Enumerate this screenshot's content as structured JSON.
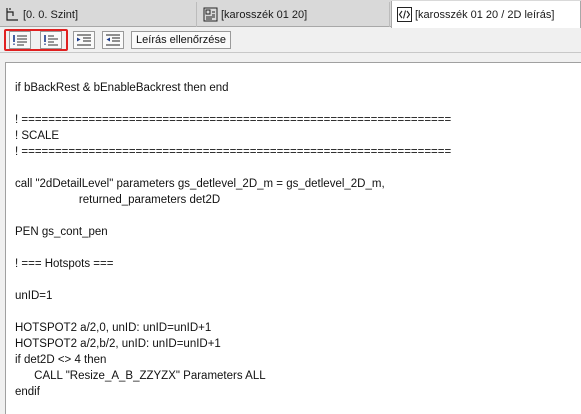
{
  "tabs": [
    {
      "label": "[0. 0. Szint]",
      "icon": "floor-plan-icon"
    },
    {
      "label": "[karosszék 01 20]",
      "icon": "object-editor-icon"
    },
    {
      "label": "[karosszék 01 20 / 2D leírás]",
      "icon": "script-code-icon",
      "active": true
    }
  ],
  "toolbar": {
    "buttons": [
      {
        "icon": "comment-lines-icon"
      },
      {
        "icon": "uncomment-lines-icon"
      },
      {
        "icon": "indent-icon"
      },
      {
        "icon": "outdent-icon"
      }
    ],
    "check_script_label": "Leírás ellenőrzése",
    "highlight_color": "#e02020"
  },
  "editor": {
    "lines": [
      "if bBackRest & bEnableBackrest then end",
      "",
      "! ================================================================",
      "! SCALE",
      "! ================================================================",
      "",
      "call \"2dDetailLevel\" parameters gs_detlevel_2D_m = gs_detlevel_2D_m,",
      "                    returned_parameters det2D",
      "",
      "PEN gs_cont_pen",
      "",
      "! === Hotspots ===",
      "",
      "unID=1",
      "",
      "HOTSPOT2 a/2,0, unID: unID=unID+1",
      "HOTSPOT2 a/2,b/2, unID: unID=unID+1",
      "if det2D <> 4 then",
      "      CALL \"Resize_A_B_ZZYZX\" Parameters ALL",
      "endif"
    ]
  }
}
